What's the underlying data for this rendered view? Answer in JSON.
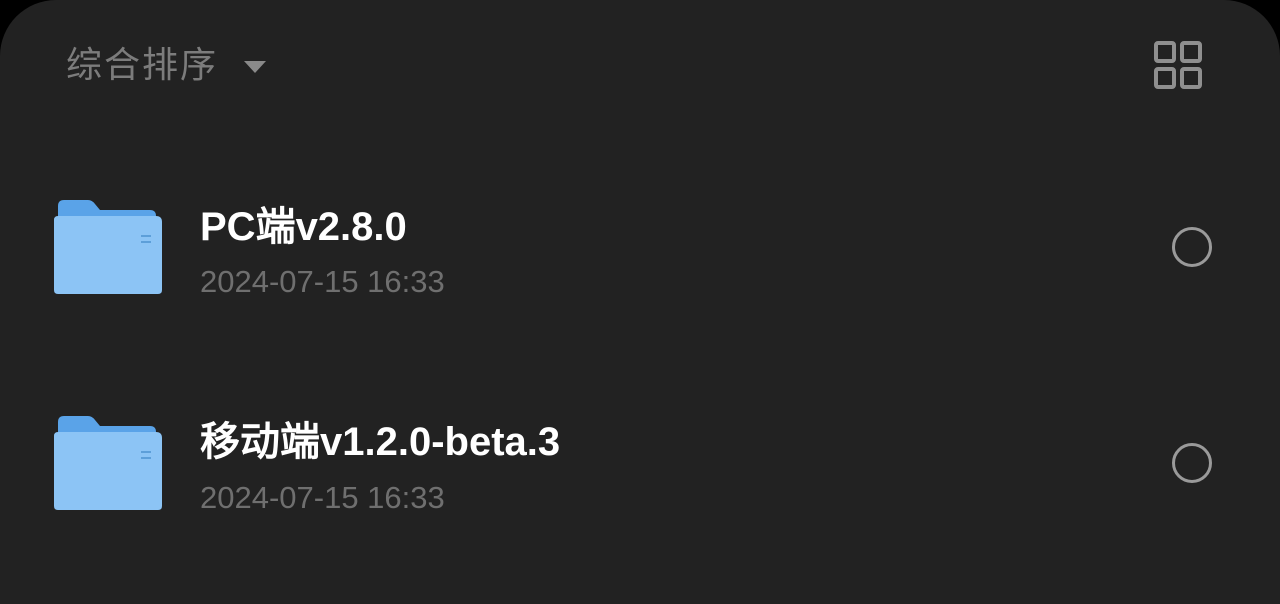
{
  "toolbar": {
    "sort_label": "综合排序",
    "sort_icon": "caret-down-icon",
    "view_toggle_icon": "grid-view-icon"
  },
  "files": [
    {
      "name": "PC端v2.8.0",
      "modified": "2024-07-15 16:33",
      "icon": "folder-icon",
      "selected": false
    },
    {
      "name": "移动端v1.2.0-beta.3",
      "modified": "2024-07-15 16:33",
      "icon": "folder-icon",
      "selected": false
    }
  ],
  "colors": {
    "background": "#222222",
    "title_text": "#ffffff",
    "secondary_text": "#6f6f6f",
    "folder_blue": "#8cc4f5",
    "radio_outline": "#9a9a9a"
  }
}
